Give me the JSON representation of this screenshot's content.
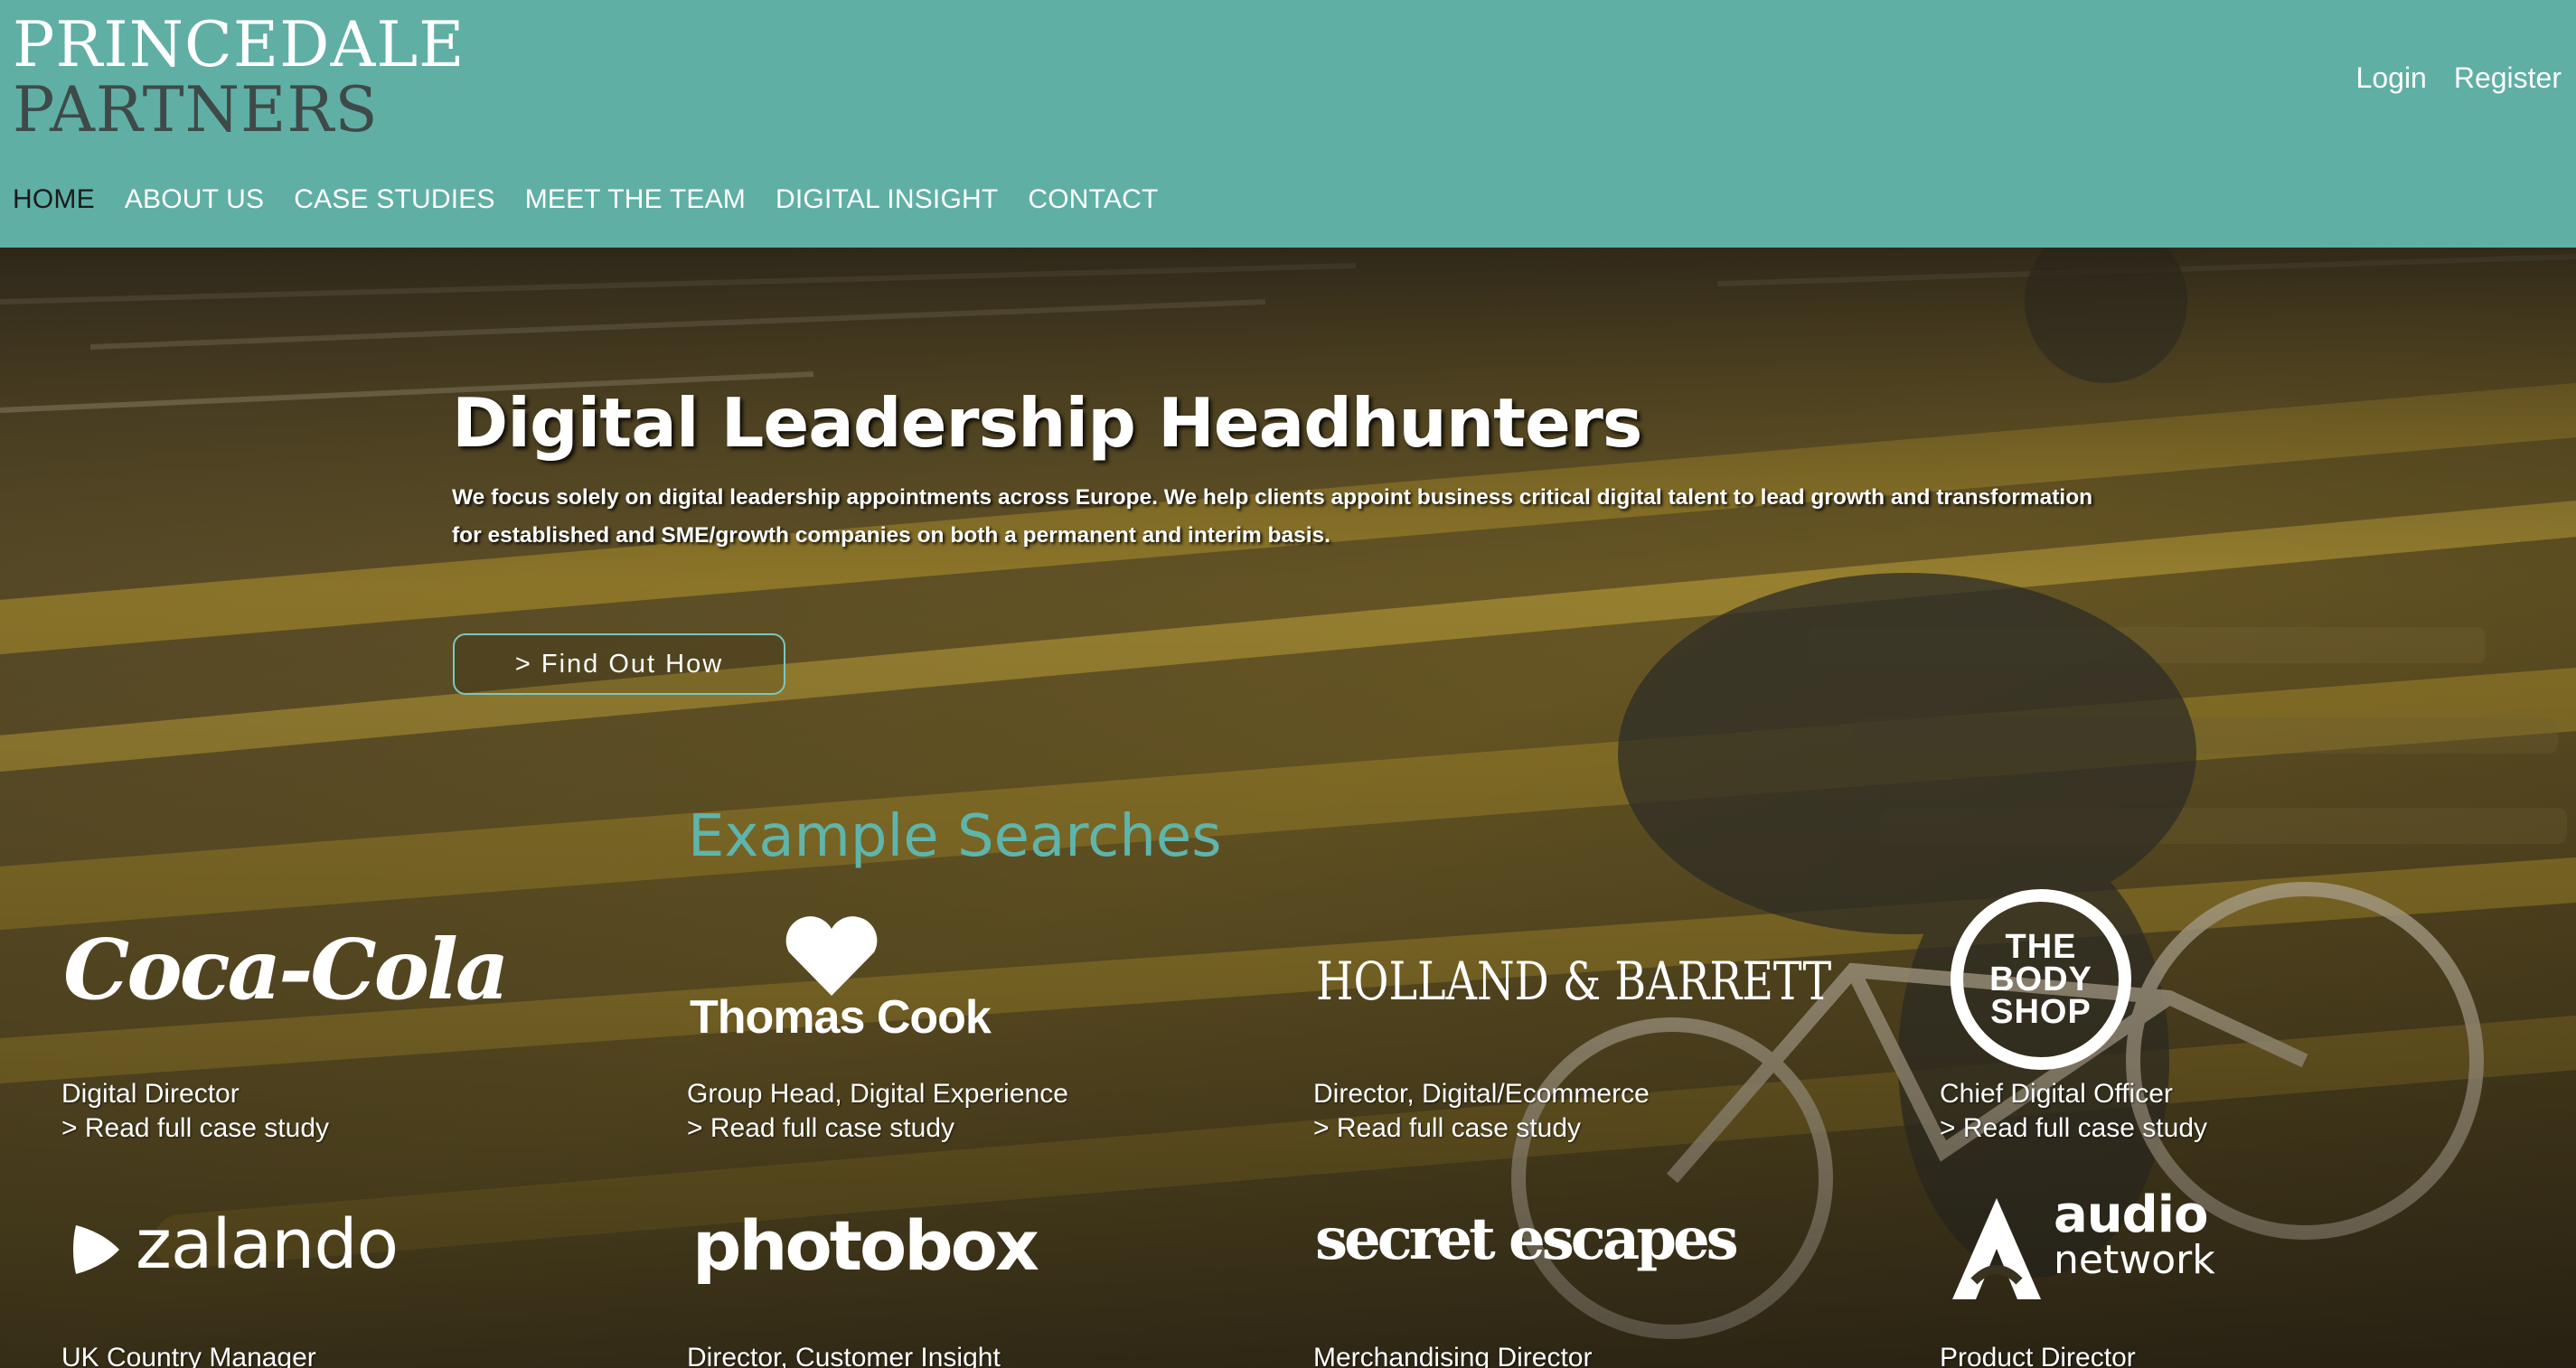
{
  "brand": {
    "line1": "PRINCEDALE",
    "line2": "PARTNERS"
  },
  "auth": {
    "login": "Login",
    "register": "Register"
  },
  "nav": [
    {
      "label": "HOME",
      "active": true
    },
    {
      "label": "ABOUT US"
    },
    {
      "label": "CASE STUDIES"
    },
    {
      "label": "MEET THE TEAM"
    },
    {
      "label": "DIGITAL INSIGHT"
    },
    {
      "label": "CONTACT"
    }
  ],
  "hero": {
    "headline": "Digital Leadership Headhunters",
    "intro": "We focus solely on digital leadership appointments across Europe. We help clients appoint business critical digital talent to lead growth and transformation for established and SME/growth companies on both a permanent and interim basis.",
    "cta": "> Find Out How"
  },
  "searches": {
    "title": "Example Searches",
    "link_text": "> Read full case study",
    "items": [
      {
        "logo": "Coca-Cola",
        "role": "Digital Director"
      },
      {
        "logo": "Thomas Cook",
        "role": "Group Head, Digital Experience"
      },
      {
        "logo": "HOLLAND & BARRETT",
        "role": "Director, Digital/Ecommerce"
      },
      {
        "logo_lines": [
          "THE",
          "BODY",
          "SHOP"
        ],
        "role": "Chief Digital Officer"
      },
      {
        "logo": "zalando",
        "role": "UK Country Manager"
      },
      {
        "logo": "photobox",
        "role": "Director, Customer Insight"
      },
      {
        "logo": "secret escapes",
        "role": "Merchandising Director"
      },
      {
        "logo_lines": [
          "audio",
          "network"
        ],
        "role": "Product Director"
      }
    ]
  },
  "colors": {
    "header_bg": "#5fafa5",
    "accent": "#5fb5ab",
    "brand_dark": "#3f4a48"
  }
}
